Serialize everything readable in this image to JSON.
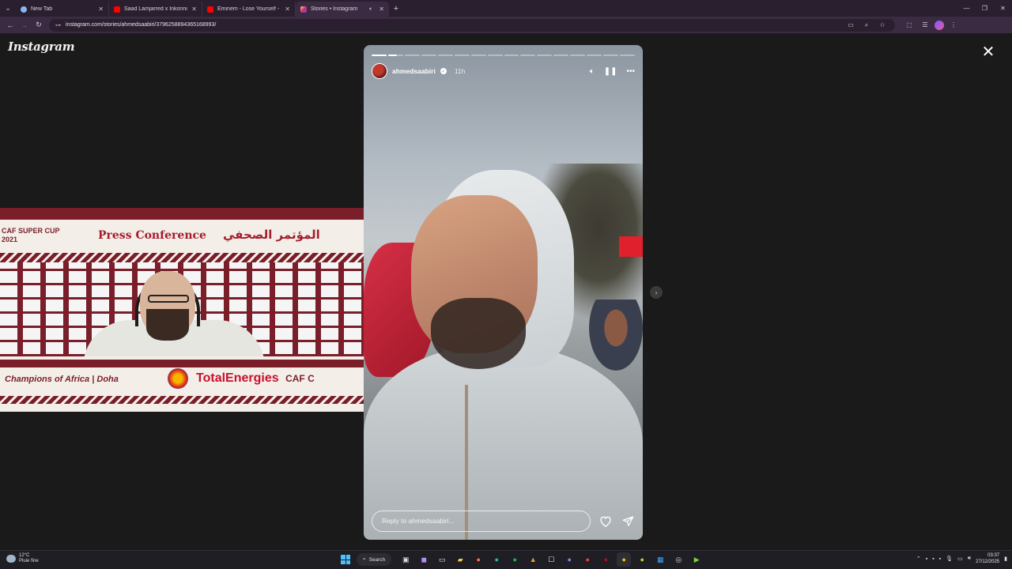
{
  "browser": {
    "tabs": [
      {
        "title": "New Tab",
        "favicon_color": "#8ab4f8",
        "active": false
      },
      {
        "title": "Saad Lamjarred x Inkonnu x Afr",
        "favicon_color": "#ff0000",
        "active": false
      },
      {
        "title": "Eminem - Lose Yourself - YouTu",
        "favicon_color": "#ff0000",
        "active": false
      },
      {
        "title": "Stories • Instagram",
        "favicon_color": "#e1306c",
        "active": true
      }
    ],
    "url": "instagram.com/stories/ahmedsaabiri/3796258894365168993/"
  },
  "instagram": {
    "logo": "Instagram"
  },
  "pip_video": {
    "header_left": "CAF SUPER CUP",
    "header_year": "2021",
    "press_title": "Press Conference",
    "press_title_ar": "المؤتمر الصحفي",
    "desk_left": "Champions of Africa",
    "desk_city": "Doha",
    "sponsor": "TotalEnergies",
    "caf_right": "CAF C"
  },
  "story": {
    "username": "ahmedsaabiri",
    "time_ago": "11h",
    "segments_total": 16,
    "segments_done": 1,
    "reply_placeholder": "Reply to ahmedsaabiri..."
  },
  "taskbar": {
    "weather_temp": "12°C",
    "weather_desc": "Pluie fine",
    "search_label": "Search",
    "time": "03:37",
    "date": "27/12/2025"
  }
}
